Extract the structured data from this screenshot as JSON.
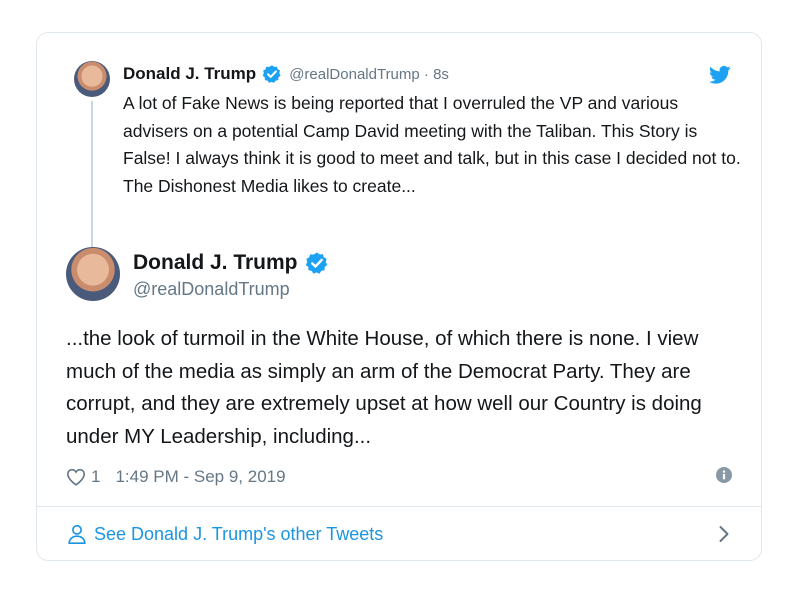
{
  "parent_tweet": {
    "name": "Donald J. Trump",
    "handle_time": "@realDonaldTrump · 8s",
    "text": "A lot of Fake News is being reported that I overruled the VP and various advisers on a potential Camp David meeting with the Taliban. This Story is False! I always think it is good to meet and talk, but in this case I decided not to. The Dishonest Media likes to create..."
  },
  "main_tweet": {
    "name": "Donald J. Trump",
    "handle": "@realDonaldTrump",
    "text": "...the look of turmoil in the White House, of which there is none. I view much of the media as simply an arm of the Democrat Party. They are corrupt, and they are extremely upset at how well our Country is doing under MY Leadership, including...",
    "like_count": "1",
    "timestamp": "1:49 PM - Sep 9, 2019"
  },
  "footer": {
    "link_text": "See Donald J. Trump's other Tweets"
  },
  "colors": {
    "accent": "#1b95e0",
    "verified": "#1da1f2",
    "muted": "#657786",
    "border": "#e1e8ed"
  },
  "icons": [
    "verified-badge-icon",
    "twitter-bird-icon",
    "heart-icon",
    "info-icon",
    "person-icon",
    "chevron-right-icon"
  ]
}
